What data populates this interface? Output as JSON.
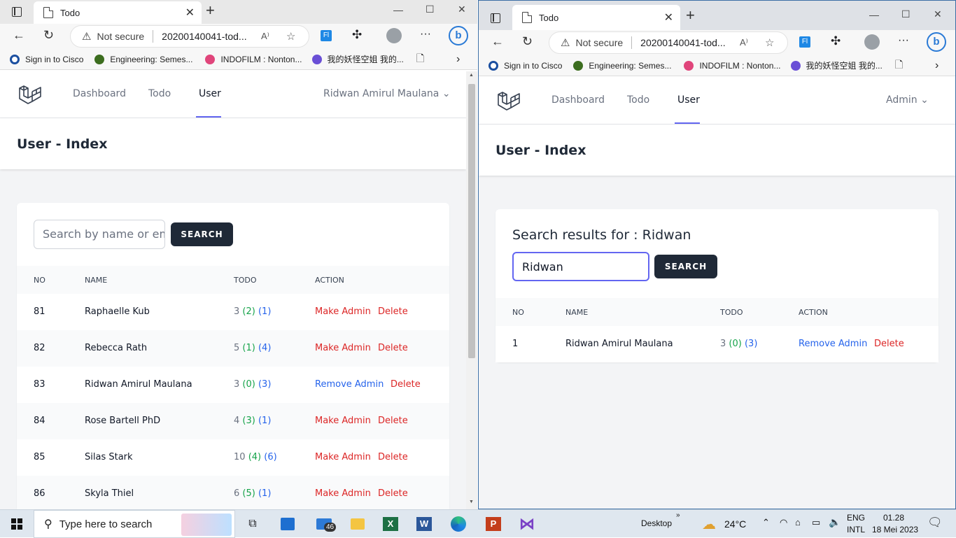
{
  "left_browser": {
    "tab_title": "Todo",
    "address": {
      "security": "Not secure",
      "url": "20200140041-tod..."
    },
    "bookmarks": [
      "Sign in to Cisco",
      "Engineering: Semes...",
      "INDOFILM : Nonton...",
      "我的妖怪空姐 我的..."
    ],
    "nav": {
      "dashboard": "Dashboard",
      "todo": "Todo",
      "user": "User",
      "user_menu": "Ridwan Amirul Maulana"
    },
    "header_title": "User - Index",
    "search": {
      "placeholder": "Search by name or em",
      "button": "SEARCH"
    },
    "table": {
      "columns": [
        "NO",
        "NAME",
        "TODO",
        "ACTION"
      ],
      "rows": [
        {
          "no": "81",
          "name": "Raphaelle Kub",
          "total": "3",
          "done": "(2)",
          "pending": "(1)",
          "action": "Make Admin",
          "delete": "Delete"
        },
        {
          "no": "82",
          "name": "Rebecca Rath",
          "total": "5",
          "done": "(1)",
          "pending": "(4)",
          "action": "Make Admin",
          "delete": "Delete"
        },
        {
          "no": "83",
          "name": "Ridwan Amirul Maulana",
          "total": "3",
          "done": "(0)",
          "pending": "(3)",
          "action": "Remove Admin",
          "delete": "Delete"
        },
        {
          "no": "84",
          "name": "Rose Bartell PhD",
          "total": "4",
          "done": "(3)",
          "pending": "(1)",
          "action": "Make Admin",
          "delete": "Delete"
        },
        {
          "no": "85",
          "name": "Silas Stark",
          "total": "10",
          "done": "(4)",
          "pending": "(6)",
          "action": "Make Admin",
          "delete": "Delete"
        },
        {
          "no": "86",
          "name": "Skyla Thiel",
          "total": "6",
          "done": "(5)",
          "pending": "(1)",
          "action": "Make Admin",
          "delete": "Delete"
        }
      ]
    }
  },
  "right_browser": {
    "tab_title": "Todo",
    "address": {
      "security": "Not secure",
      "url": "20200140041-tod..."
    },
    "bookmarks": [
      "Sign in to Cisco",
      "Engineering: Semes...",
      "INDOFILM : Nonton...",
      "我的妖怪空姐 我的..."
    ],
    "nav": {
      "dashboard": "Dashboard",
      "todo": "Todo",
      "user": "User",
      "user_menu": "Admin"
    },
    "header_title": "User - Index",
    "results_title": "Search results for : Ridwan",
    "search": {
      "value": "Ridwan",
      "button": "SEARCH"
    },
    "table": {
      "columns": [
        "NO",
        "NAME",
        "TODO",
        "ACTION"
      ],
      "rows": [
        {
          "no": "1",
          "name": "Ridwan Amirul Maulana",
          "total": "3",
          "done": "(0)",
          "pending": "(3)",
          "action": "Remove Admin",
          "delete": "Delete"
        }
      ]
    }
  },
  "taskbar": {
    "search_placeholder": "Type here to search",
    "mail_badge": "46",
    "desktop_label": "Desktop",
    "temperature": "24°C",
    "lang_top": "ENG",
    "lang_bottom": "INTL",
    "time": "01.28",
    "date": "18 Mei 2023"
  },
  "colors": {
    "accent": "#6366f1",
    "dark_button": "#1f2937",
    "danger": "#dc2626",
    "link_blue": "#2563eb",
    "success": "#16a34a"
  }
}
